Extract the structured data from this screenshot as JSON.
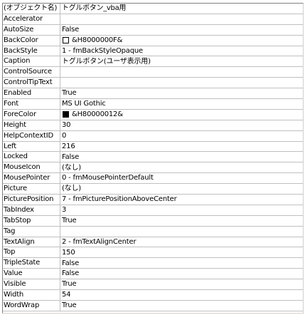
{
  "header": {
    "name": "(オブジェクト名)",
    "value": "トグルボタン_vba用"
  },
  "colors": {
    "back_color_swatch": "#ffffff",
    "fore_color_swatch": "#000000"
  },
  "properties": [
    {
      "name": "Accelerator",
      "value": ""
    },
    {
      "name": "AutoSize",
      "value": "False"
    },
    {
      "name": "BackColor",
      "value": "&H8000000F&"
    },
    {
      "name": "BackStyle",
      "value": "1 - fmBackStyleOpaque"
    },
    {
      "name": "Caption",
      "value": "トグルボタン(ユーザ表示用)"
    },
    {
      "name": "ControlSource",
      "value": ""
    },
    {
      "name": "ControlTipText",
      "value": ""
    },
    {
      "name": "Enabled",
      "value": "True"
    },
    {
      "name": "Font",
      "value": "MS UI Gothic"
    },
    {
      "name": "ForeColor",
      "value": "&H80000012&"
    },
    {
      "name": "Height",
      "value": "30"
    },
    {
      "name": "HelpContextID",
      "value": "0"
    },
    {
      "name": "Left",
      "value": "216"
    },
    {
      "name": "Locked",
      "value": "False"
    },
    {
      "name": "MouseIcon",
      "value": "(なし)"
    },
    {
      "name": "MousePointer",
      "value": "0 - fmMousePointerDefault"
    },
    {
      "name": "Picture",
      "value": "(なし)"
    },
    {
      "name": "PicturePosition",
      "value": "7 - fmPicturePositionAboveCenter"
    },
    {
      "name": "TabIndex",
      "value": "3"
    },
    {
      "name": "TabStop",
      "value": "True"
    },
    {
      "name": "Tag",
      "value": ""
    },
    {
      "name": "TextAlign",
      "value": "2 - fmTextAlignCenter"
    },
    {
      "name": "Top",
      "value": "150"
    },
    {
      "name": "TripleState",
      "value": "False"
    },
    {
      "name": "Value",
      "value": "False"
    },
    {
      "name": "Visible",
      "value": "True"
    },
    {
      "name": "Width",
      "value": "54"
    },
    {
      "name": "WordWrap",
      "value": "True"
    }
  ]
}
